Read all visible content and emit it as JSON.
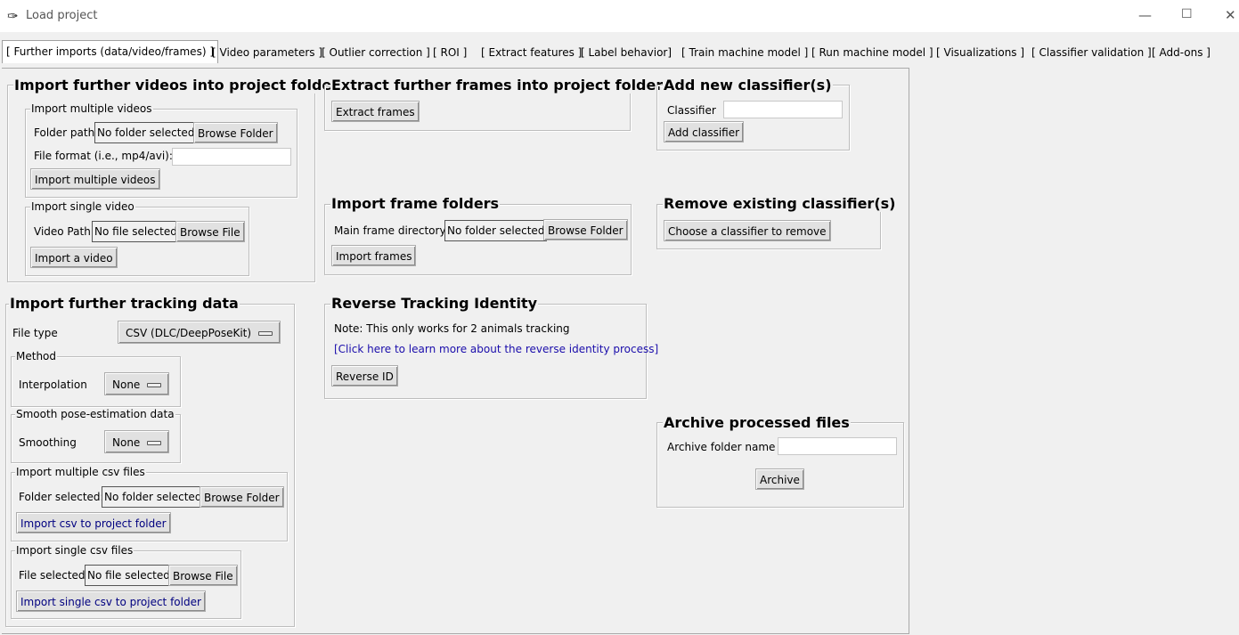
{
  "window": {
    "title": "Load project",
    "icon": "feather-icon"
  },
  "tabs": [
    "[ Further imports (data/video/frames) ]",
    "[ Video parameters ]",
    "[ Outlier correction ]",
    "[ ROI ]",
    "[ Extract features ]",
    "[ Label behavior]",
    "[ Train machine model ]",
    "[ Run machine model ]",
    "[ Visualizations ]",
    "[ Classifier validation ]",
    "[ Add-ons ]"
  ],
  "import_videos": {
    "title": "Import further videos into project folder",
    "multiple": {
      "title": "Import multiple videos",
      "folder_label": "Folder path",
      "folder_status": "No folder selected",
      "browse": "Browse Folder",
      "format_label": "File format (i.e., mp4/avi):",
      "format_value": "",
      "import_button": "Import multiple videos"
    },
    "single": {
      "title": "Import single video",
      "path_label": "Video Path",
      "file_status": "No file selected",
      "browse": "Browse File",
      "import_button": "Import a video"
    }
  },
  "tracking": {
    "title": "Import further tracking data",
    "file_type_label": "File type",
    "file_type_value": "CSV (DLC/DeepPoseKit)",
    "method": {
      "title": "Method",
      "label": "Interpolation",
      "value": "None"
    },
    "smooth": {
      "title": "Smooth pose-estimation data",
      "label": "Smoothing",
      "value": "None"
    },
    "multi_csv": {
      "title": "Import multiple csv files",
      "label": "Folder selected:",
      "status": "No folder selected",
      "browse": "Browse Folder",
      "button": "Import csv to project folder"
    },
    "single_csv": {
      "title": "Import single csv files",
      "label": "File selected",
      "status": "No file selected",
      "browse": "Browse File",
      "button": "Import single csv to project folder"
    }
  },
  "extract_frames": {
    "title": "Extract further frames into project folder",
    "button": "Extract frames"
  },
  "frame_folders": {
    "title": "Import frame folders",
    "label": "Main frame directory",
    "status": "No folder selected",
    "browse": "Browse Folder",
    "button": "Import frames"
  },
  "reverse": {
    "title": "Reverse Tracking Identity",
    "note": "Note: This only works for 2 animals tracking",
    "link": "[Click here to learn more about the reverse identity process]",
    "button": "Reverse ID"
  },
  "add_classifier": {
    "title": "Add new classifier(s)",
    "label": "Classifier",
    "value": "",
    "button": "Add classifier"
  },
  "remove_classifier": {
    "title": "Remove existing classifier(s)",
    "button": "Choose a classifier to remove"
  },
  "archive": {
    "title": "Archive processed files",
    "label": "Archive folder name",
    "value": "",
    "button": "Archive"
  }
}
